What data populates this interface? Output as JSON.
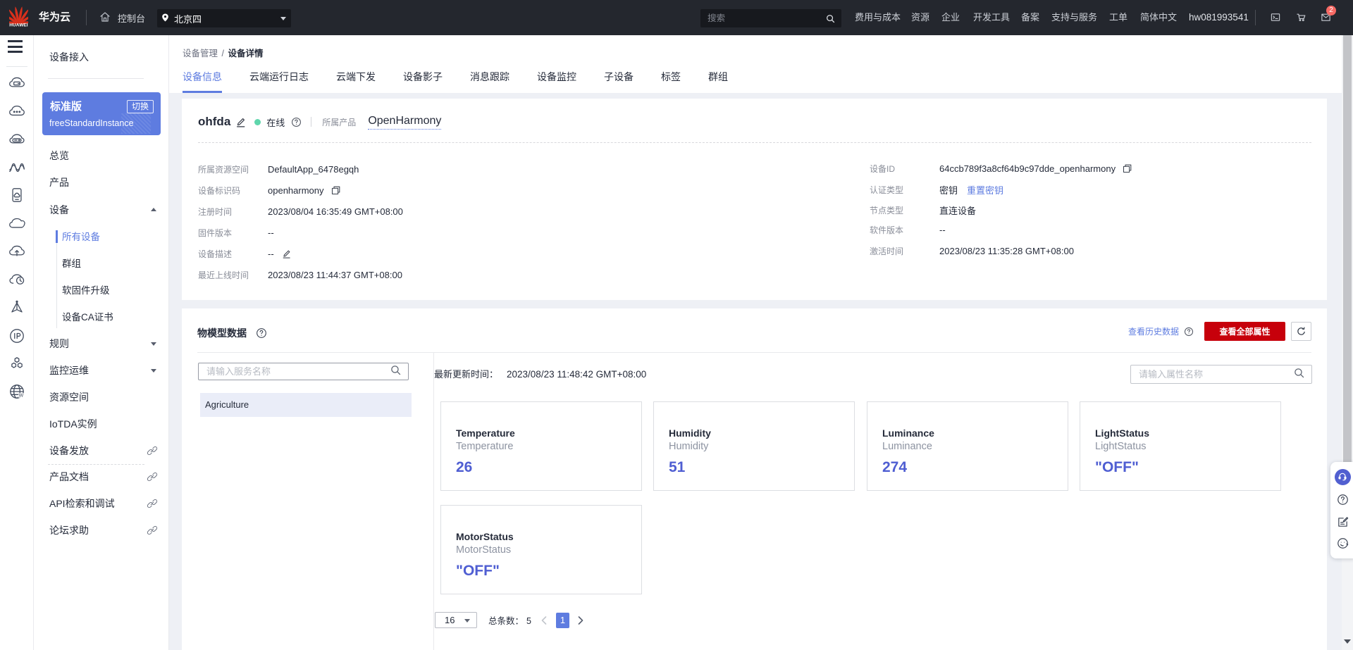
{
  "topbar": {
    "brand": "华为云",
    "brand_logo_text": "HUAWEI",
    "console": "控制台",
    "region": "北京四",
    "search_placeholder": "搜索",
    "links": [
      "费用与成本",
      "资源",
      "企业",
      "开发工具",
      "备案",
      "支持与服务",
      "工单",
      "简体中文"
    ],
    "username": "hw081993541",
    "mail_badge": "2"
  },
  "sidebar": {
    "title": "设备接入",
    "instance": {
      "edition": "标准版",
      "switch_label": "切换",
      "name": "freeStandardInstance"
    },
    "items": [
      {
        "label": "总览"
      },
      {
        "label": "产品"
      },
      {
        "label": "设备",
        "expanded": true
      },
      {
        "label": "所有设备",
        "active": true
      },
      {
        "label": "群组"
      },
      {
        "label": "软固件升级"
      },
      {
        "label": "设备CA证书"
      },
      {
        "label": "规则"
      },
      {
        "label": "监控运维"
      },
      {
        "label": "资源空间"
      },
      {
        "label": "IoTDA实例"
      },
      {
        "label": "设备发放"
      },
      {
        "label": "产品文档"
      },
      {
        "label": "API检索和调试"
      },
      {
        "label": "论坛求助"
      }
    ]
  },
  "breadcrumb": {
    "parent": "设备管理",
    "separator": "/",
    "current": "设备详情"
  },
  "tabs": [
    {
      "label": "设备信息"
    },
    {
      "label": "云端运行日志"
    },
    {
      "label": "云端下发"
    },
    {
      "label": "设备影子"
    },
    {
      "label": "消息跟踪"
    },
    {
      "label": "设备监控"
    },
    {
      "label": "子设备"
    },
    {
      "label": "标签"
    },
    {
      "label": "群组"
    }
  ],
  "device": {
    "name": "ohfda",
    "status": "在线",
    "product_label": "所属产品",
    "product": "OpenHarmony",
    "fields_left": [
      {
        "label": "所属资源空间",
        "value": "DefaultApp_6478egqh"
      },
      {
        "label": "设备标识码",
        "value": "openharmony",
        "copy": true
      },
      {
        "label": "注册时间",
        "value": "2023/08/04 16:35:49 GMT+08:00"
      },
      {
        "label": "固件版本",
        "value": "--"
      },
      {
        "label": "设备描述",
        "value": "--",
        "edit": true
      },
      {
        "label": "最近上线时间",
        "value": "2023/08/23 11:44:37 GMT+08:00"
      }
    ],
    "fields_right": [
      {
        "label": "设备ID",
        "value": "64ccb789f3a8cf64b9c97dde_openharmony",
        "copy": true
      },
      {
        "label": "认证类型",
        "value": "密钥",
        "link": "重置密钥"
      },
      {
        "label": "节点类型",
        "value": "直连设备"
      },
      {
        "label": "软件版本",
        "value": "--"
      },
      {
        "label": "激活时间",
        "value": "2023/08/23 11:35:28 GMT+08:00"
      }
    ]
  },
  "model": {
    "title": "物模型数据",
    "history_link": "查看历史数据",
    "all_props_button": "查看全部属性",
    "service_search_placeholder": "请输入服务名称",
    "service_selected": "Agriculture",
    "updated_label": "最新更新时间：",
    "updated_value": "2023/08/23 11:48:42 GMT+08:00",
    "attr_search_placeholder": "请输入属性名称",
    "cards": [
      {
        "title": "Temperature",
        "subtitle": "Temperature",
        "value": "26"
      },
      {
        "title": "Humidity",
        "subtitle": "Humidity",
        "value": "51"
      },
      {
        "title": "Luminance",
        "subtitle": "Luminance",
        "value": "274"
      },
      {
        "title": "LightStatus",
        "subtitle": "LightStatus",
        "value": "\"OFF\""
      },
      {
        "title": "MotorStatus",
        "subtitle": "MotorStatus",
        "value": "\"OFF\""
      }
    ],
    "pagination": {
      "page_size": "16",
      "total_label": "总条数：",
      "total": "5",
      "page": "1"
    }
  },
  "colors": {
    "accent": "#5e7ce0",
    "value_blue": "#4f5ed2",
    "danger_red": "#c7000b",
    "online_green": "#5fd6ac",
    "topbar_bg": "#24272e"
  }
}
